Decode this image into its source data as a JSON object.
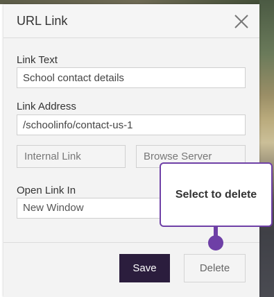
{
  "dialog": {
    "title": "URL Link",
    "link_text": {
      "label": "Link Text",
      "value": "School contact details"
    },
    "link_address": {
      "label": "Link Address",
      "value": "/schoolinfo/contact-us-1"
    },
    "internal_link_label": "Internal Link",
    "browse_server_label": "Browse Server",
    "open_link_in": {
      "label": "Open Link In",
      "value": "New Window"
    },
    "save_label": "Save",
    "delete_label": "Delete"
  },
  "tooltip": {
    "text": "Select to delete"
  },
  "colors": {
    "accent": "#6e3fa6",
    "save_bg": "#2b1d3d"
  },
  "icons": {
    "close": "close-icon"
  }
}
